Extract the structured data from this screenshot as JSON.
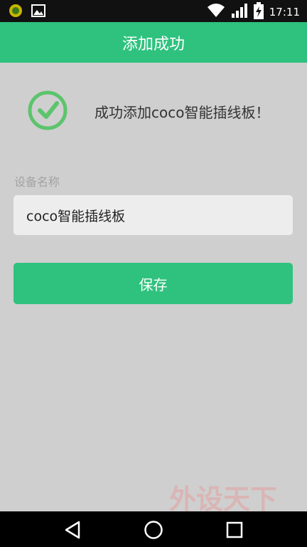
{
  "status_bar": {
    "time": "17:11",
    "icons": [
      "notification-coin-icon",
      "gallery-icon",
      "wifi-icon",
      "signal-icon",
      "battery-charging-icon"
    ]
  },
  "app_bar": {
    "title": "添加成功"
  },
  "success": {
    "message": "成功添加coco智能插线板！",
    "icon": "check-circle-icon",
    "icon_color": "#5cc46c"
  },
  "form": {
    "label": "设备名称",
    "value": "coco智能插线板"
  },
  "save_button": {
    "label": "保存",
    "color": "#2ec27e"
  },
  "nav_bar": {
    "icons": [
      "back-icon",
      "home-icon",
      "recents-icon"
    ]
  },
  "watermark": {
    "text": "外设天下",
    "url": "www.pcwaishe.cn"
  }
}
